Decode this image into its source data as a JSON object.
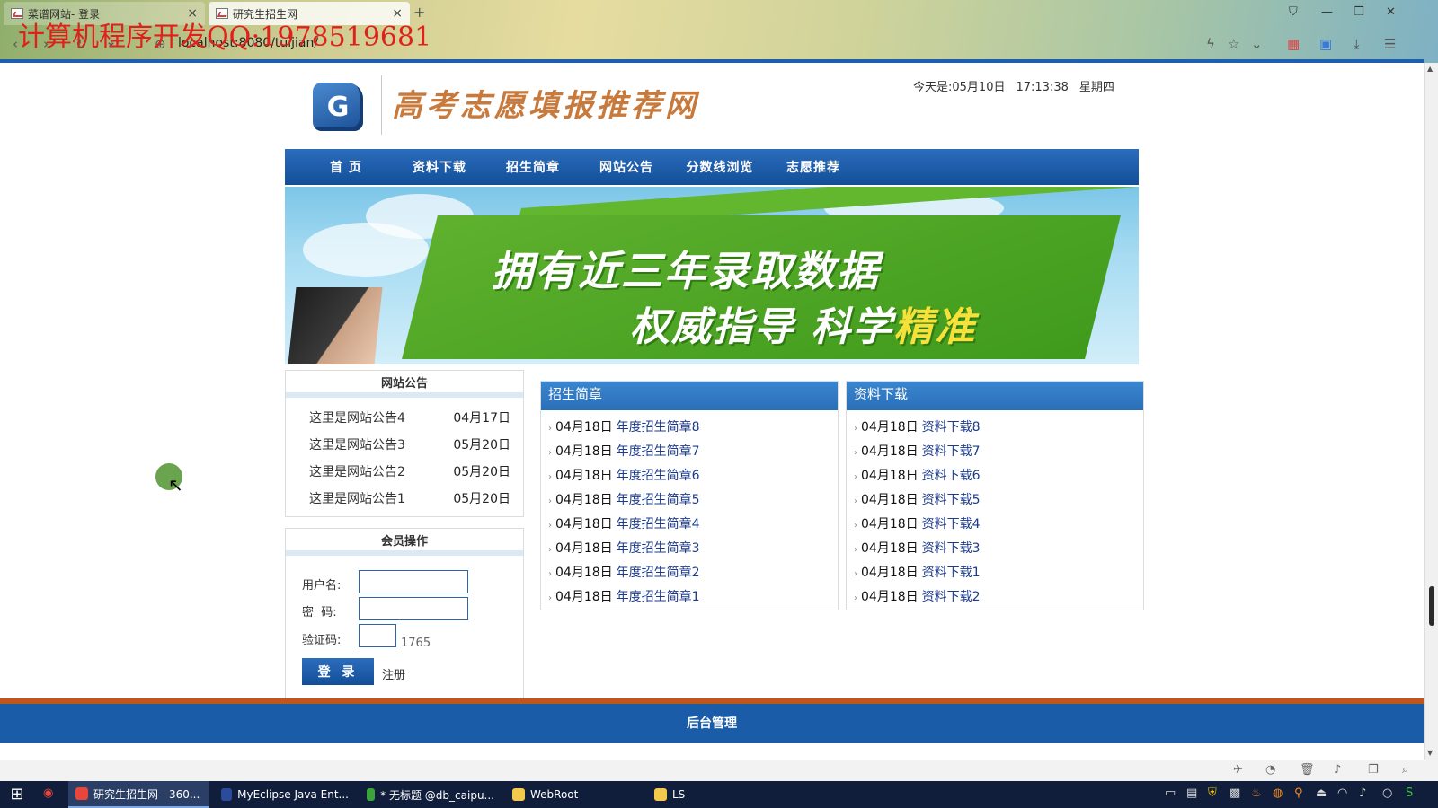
{
  "browser": {
    "tabs": [
      {
        "label": "菜谱网站- 登录",
        "close": "×"
      },
      {
        "label": "研究生招生网",
        "close": "×"
      }
    ],
    "new_tab": "+",
    "address": "localhost:8080/tuijian/",
    "watermark": "计算机程序开发QQ:1978519681"
  },
  "header": {
    "logo_letter": "G",
    "site_title": "高考志愿填报推荐网",
    "date_prefix": "今天是:05月10日",
    "time": "17:13:38",
    "weekday": "星期四"
  },
  "nav": {
    "items": [
      "首 页",
      "资料下载",
      "招生简章",
      "网站公告",
      "分数线浏览",
      "志愿推荐"
    ]
  },
  "banner": {
    "line1": "拥有近三年录取数据",
    "line2_a": "权威指导  科学",
    "line2_b": "精准"
  },
  "notice": {
    "title": "网站公告",
    "items": [
      {
        "title": "这里是网站公告4",
        "date": "04月17日"
      },
      {
        "title": "这里是网站公告3",
        "date": "05月20日"
      },
      {
        "title": "这里是网站公告2",
        "date": "05月20日"
      },
      {
        "title": "这里是网站公告1",
        "date": "05月20日"
      }
    ]
  },
  "login": {
    "title": "会员操作",
    "username_label": "用户名:",
    "password_label": "密  码:",
    "code_label": "验证码:",
    "code_value": "1765",
    "login_button": "登 录",
    "register_link": "注册"
  },
  "admissions": {
    "title": "招生简章",
    "items": [
      {
        "date": "04月18日",
        "title": "年度招生简章8"
      },
      {
        "date": "04月18日",
        "title": "年度招生简章7"
      },
      {
        "date": "04月18日",
        "title": "年度招生简章6"
      },
      {
        "date": "04月18日",
        "title": "年度招生简章5"
      },
      {
        "date": "04月18日",
        "title": "年度招生简章4"
      },
      {
        "date": "04月18日",
        "title": "年度招生简章3"
      },
      {
        "date": "04月18日",
        "title": "年度招生简章2"
      },
      {
        "date": "04月18日",
        "title": "年度招生简章1"
      }
    ]
  },
  "downloads": {
    "title": "资料下载",
    "items": [
      {
        "date": "04月18日",
        "title": "资料下载8"
      },
      {
        "date": "04月18日",
        "title": "资料下载7"
      },
      {
        "date": "04月18日",
        "title": "资料下载6"
      },
      {
        "date": "04月18日",
        "title": "资料下载5"
      },
      {
        "date": "04月18日",
        "title": "资料下载4"
      },
      {
        "date": "04月18日",
        "title": "资料下载3"
      },
      {
        "date": "04月18日",
        "title": "资料下载1"
      },
      {
        "date": "04月18日",
        "title": "资料下载2"
      }
    ]
  },
  "footer": {
    "admin_link": "后台管理"
  },
  "taskbar": {
    "tasks": [
      {
        "label": "研究生招生网 - 360...",
        "color": "#e8453c"
      },
      {
        "label": "MyEclipse Java Ent...",
        "color": "#2a4c9a"
      },
      {
        "label": "* 无标题 @db_caipu...",
        "color": "#3aa33a"
      },
      {
        "label": "WebRoot",
        "color": "#f2c94c"
      },
      {
        "label": "LS",
        "color": "#f2c94c"
      }
    ]
  },
  "colors": {
    "nav_blue": "#1a5ca8",
    "footer_orange": "#c0561a",
    "title_orange": "#c87a3c",
    "banner_green": "#4fa624"
  }
}
